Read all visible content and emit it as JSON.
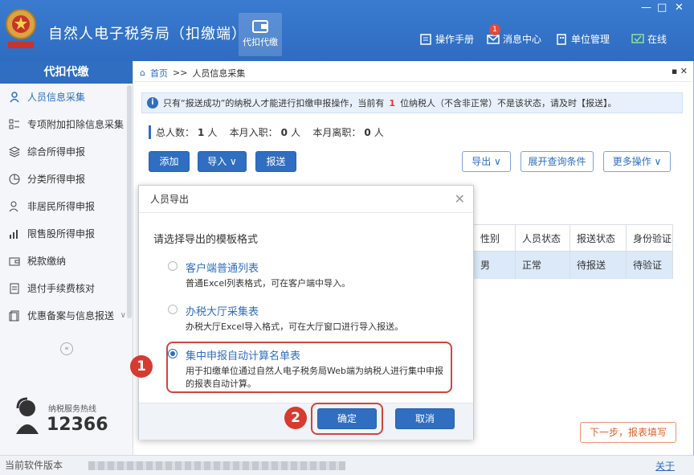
{
  "window": {
    "title": "自然人电子税务局（扣缴端）",
    "controls": [
      "—",
      "□",
      "✕"
    ]
  },
  "toolbar": {
    "module_label": "代扣代缴",
    "items": [
      {
        "label": "操作手册",
        "icon": "manual-icon"
      },
      {
        "label": "消息中心",
        "icon": "mail-icon",
        "badge": "1"
      },
      {
        "label": "单位管理",
        "icon": "building-icon"
      },
      {
        "label": "在线",
        "icon": "online-monitor-icon"
      }
    ]
  },
  "sidebar": {
    "header": "代扣代缴",
    "items": [
      {
        "label": "人员信息采集",
        "icon": "person-icon",
        "active": true
      },
      {
        "label": "专项附加扣除信息采集",
        "icon": "list-icon"
      },
      {
        "label": "综合所得申报",
        "icon": "layers-icon"
      },
      {
        "label": "分类所得申报",
        "icon": "pie-icon"
      },
      {
        "label": "非居民所得申报",
        "icon": "person-outline-icon"
      },
      {
        "label": "限售股所得申报",
        "icon": "bar-chart-icon"
      },
      {
        "label": "税款缴纳",
        "icon": "wallet-icon"
      },
      {
        "label": "退付手续费核对",
        "icon": "check-doc-icon"
      },
      {
        "label": "优惠备案与信息报送",
        "icon": "doc-icon"
      }
    ],
    "collapse": "«",
    "hotline_label": "纳税服务热线",
    "hotline_number": "12366"
  },
  "breadcrumb": {
    "home": "首页",
    "sep": ">>",
    "current": "人员信息采集",
    "controls": "▪ ✕"
  },
  "notice": {
    "part1": "只有“报送成功”的纳税人才能进行扣缴申报操作，当前有",
    "count": "1",
    "part2": "位纳税人（不含非正常）不是该状态，请及时【报送】。"
  },
  "stats": {
    "total_label": "总人数：",
    "total": "1",
    "unit1": "人",
    "joined_label": "本月入职：",
    "joined": "0",
    "unit2": "人",
    "left_label": "本月离职：",
    "left": "0",
    "unit3": "人"
  },
  "actions": {
    "add": "添加",
    "import": "导入 ∨",
    "submit": "报送",
    "export": "导出 ∨",
    "expand_query": "展开查询条件",
    "more": "更多操作 ∨"
  },
  "table": {
    "headers": [
      "性别",
      "人员状态",
      "报送状态",
      "身份验证状"
    ],
    "rows": [
      [
        "男",
        "正常",
        "待报送",
        "待验证"
      ]
    ]
  },
  "next_button": "下一步，报表填写",
  "dialog": {
    "title": "人员导出",
    "close": "✕",
    "prompt": "请选择导出的模板格式",
    "options": [
      {
        "title": "客户端普通列表",
        "desc": "普通Excel列表格式，可在客户端中导入。",
        "selected": false
      },
      {
        "title": "办税大厅采集表",
        "desc": "办税大厅Excel导入格式，可在大厅窗口进行导入报送。",
        "selected": false
      },
      {
        "title": "集中申报自动计算名单表",
        "desc": "用于扣缴单位通过自然人电子税务局Web端为纳税人进行集中申报的报表自动计算。",
        "selected": true
      }
    ],
    "ok": "确定",
    "cancel": "取消"
  },
  "markers": [
    "1",
    "2"
  ],
  "statusbar": {
    "watermark": "当前软件版本",
    "about": "关于"
  },
  "colors": {
    "brand": "#2f6ec0",
    "highlight": "#d2453a",
    "accent_red": "#d93a2b"
  }
}
